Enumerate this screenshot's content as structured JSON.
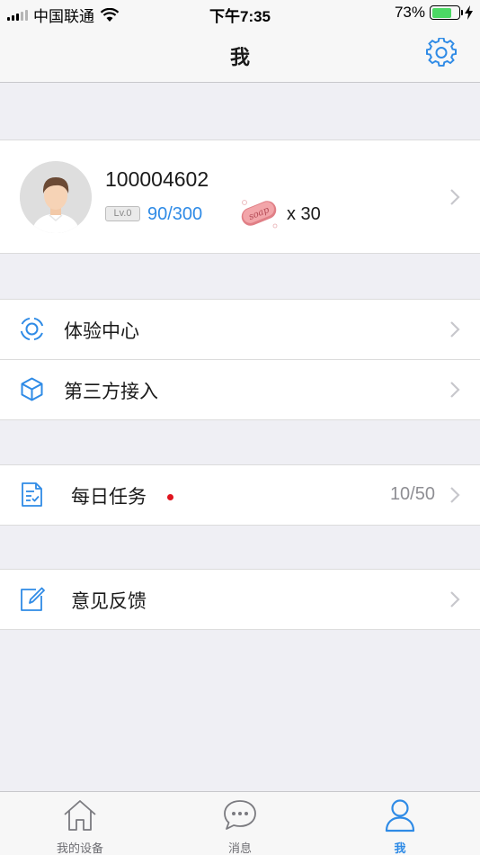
{
  "status_bar": {
    "carrier": "中国联通",
    "time": "下午7:35",
    "battery_percent": "73%",
    "battery_level": 0.73
  },
  "nav": {
    "title": "我"
  },
  "profile": {
    "user_id": "100004602",
    "level_badge": "Lv.0",
    "experience": "90/300",
    "soap_count": "x 30",
    "soap_text": "soap"
  },
  "menu": {
    "experience_center": "体验中心",
    "third_party": "第三方接入",
    "daily_tasks": "每日任务",
    "daily_tasks_count": "10/50",
    "feedback": "意见反馈"
  },
  "tabs": [
    {
      "label": "我的设备",
      "icon": "home-icon",
      "active": false
    },
    {
      "label": "消息",
      "icon": "chat-bubble-icon",
      "active": false
    },
    {
      "label": "我",
      "icon": "person-icon",
      "active": true
    }
  ],
  "colors": {
    "accent": "#2f8be6",
    "notification_dot": "#e0141e",
    "battery": "#4cd964"
  }
}
